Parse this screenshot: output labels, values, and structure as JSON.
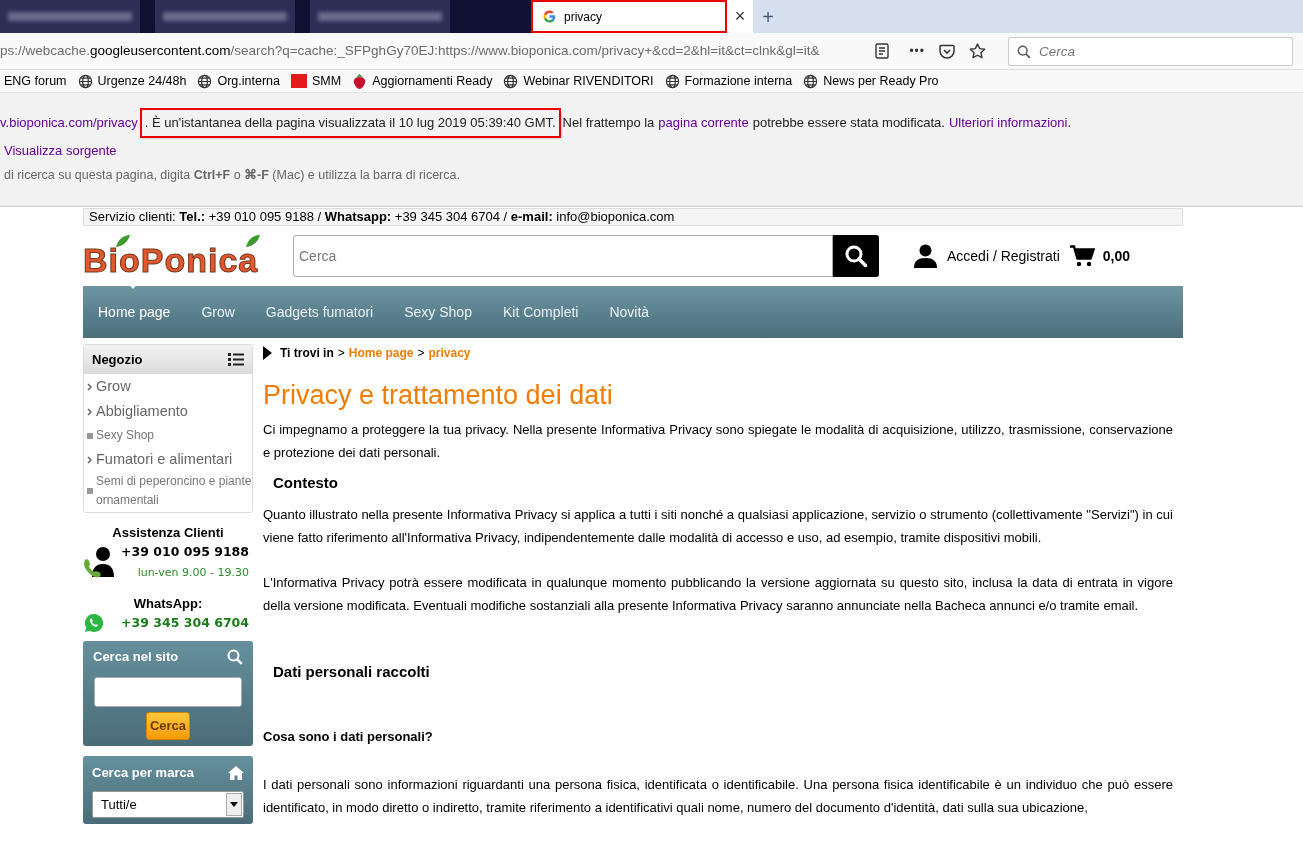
{
  "browser": {
    "tabs": [
      {
        "kind": "blurred",
        "selected": false,
        "highlighted": false
      },
      {
        "kind": "blurred",
        "selected": false,
        "highlighted": false
      },
      {
        "kind": "blurred",
        "selected": false,
        "highlighted": false
      },
      {
        "kind": "page",
        "title": "privacy",
        "selected": true,
        "highlighted": true
      }
    ],
    "close_tab": "×",
    "new_tab": "+",
    "url": {
      "prefix": "ps://webcache.",
      "domain": "googleusercontent.com",
      "rest": "/search?q=cache:_SFPghGy70EJ:https://www.bioponica.com/privacy+&cd=2&hl=it&ct=clnk&gl=it&"
    },
    "menu_dots": "•••",
    "search_placeholder": "Cerca",
    "bookmarks": [
      {
        "kind": "plain",
        "label": "ENG forum"
      },
      {
        "kind": "globe",
        "label": "Urgenze 24/48h"
      },
      {
        "kind": "globe",
        "label": "Org.interna"
      },
      {
        "kind": "badge",
        "label": "SMM"
      },
      {
        "kind": "strawberry",
        "label": "Aggiornamenti Ready"
      },
      {
        "kind": "globe",
        "label": "Webinar RIVENDITORI"
      },
      {
        "kind": "globe",
        "label": "Formazione interna"
      },
      {
        "kind": "globe",
        "label": "News per Ready Pro"
      }
    ]
  },
  "cache_banner": {
    "lines": [
      [
        {
          "kind": "link",
          "text": "v.bioponica.com/privacy",
          "highlighted": false
        },
        {
          "kind": "text",
          "text": ". È un'istantanea della pagina visualizzata il 10 lug 2019 05:39:40 GMT.",
          "highlighted": true
        },
        {
          "kind": "text",
          "text": "Nel frattempo la",
          "highlighted": false
        },
        {
          "kind": "link",
          "text": "pagina corrente",
          "highlighted": false
        },
        {
          "kind": "text",
          "text": "potrebbe essere stata modificata.",
          "highlighted": false
        },
        {
          "kind": "link",
          "text": "Ulteriori informazioni.",
          "highlighted": false
        }
      ],
      [
        {
          "kind": "link",
          "text": "Visualizza sorgente",
          "highlighted": false
        }
      ],
      [
        {
          "kind": "rich",
          "text": "di ricerca su questa pagina, digita **Ctrl+F** o **⌘-F** (Mac) e utilizza la barra di ricerca.",
          "highlighted": false
        }
      ]
    ]
  },
  "site": {
    "contact_bar": "Servizio clienti: **Tel.:** +39 010 095 9188 / **Whatsapp:** +39 345 304 6704 / **e-mail:** info@bioponica.com",
    "logo": "BioPonica",
    "search_placeholder": "Cerca",
    "account": "Accedi / Registrati",
    "cart_total": "0,00",
    "nav": [
      {
        "label": "Home page",
        "selected": true
      },
      {
        "label": "Grow",
        "selected": false
      },
      {
        "label": "Gadgets fumatori",
        "selected": false
      },
      {
        "label": "Sexy Shop",
        "selected": false
      },
      {
        "label": "Kit Completi",
        "selected": false
      },
      {
        "label": "Novità",
        "selected": false
      }
    ],
    "sidebar": {
      "shop_title": "Negozio",
      "categories": [
        {
          "kind": "arrow",
          "label": "Grow"
        },
        {
          "kind": "arrow",
          "label": "Abbigliamento"
        },
        {
          "kind": "square",
          "label": "Sexy Shop"
        },
        {
          "kind": "arrow",
          "label": "Fumatori e alimentari"
        },
        {
          "kind": "square",
          "label": "Semi di peperoncino e piante ornamentali"
        }
      ],
      "support_title": "Assistenza Clienti",
      "support_phone": "+39 010 095 9188",
      "support_hours": "lun-ven 9.00 - 19.30",
      "whatsapp_title": "WhatsApp:",
      "whatsapp_phone": "+39 345 304 6704",
      "site_search_title": "Cerca nel sito",
      "site_search_button": "Cerca",
      "brand_title": "Cerca per marca",
      "brand_value": "Tutti/e"
    },
    "breadcrumb": {
      "label": "Ti trovi in",
      "separator": ">",
      "items": [
        "Home page",
        "privacy"
      ]
    },
    "content": [
      {
        "kind": "title",
        "text": "Privacy e trattamento dei dati"
      },
      {
        "kind": "paragraph",
        "text": "Ci impegnamo a proteggere la tua privacy. Nella presente Informativa Privacy sono spiegate le modalità di acquisizione, utilizzo, trasmissione, conservazione e protezione dei dati personali."
      },
      {
        "kind": "heading",
        "text": "Contesto"
      },
      {
        "kind": "paragraph",
        "text": "Quanto illustrato nella presente Informativa Privacy si applica a tutti i siti nonché a qualsiasi applicazione, servizio o strumento (collettivamente \"Servizi\") in cui viene fatto riferimento all'Informativa Privacy, indipendentemente dalle modalità di accesso e uso, ad esempio, tramite dispositivi mobili."
      },
      {
        "kind": "paragraph",
        "text": "L'Informativa Privacy potrà essere modificata in qualunque momento pubblicando la versione aggiornata su questo sito, inclusa la data di entrata in vigore della versione modificata. Eventuali modifiche sostanziali alla presente Informativa Privacy saranno annunciate nella Bacheca annunci e/o tramite email."
      },
      {
        "kind": "heading",
        "text": "Dati personali raccolti"
      },
      {
        "kind": "subheading",
        "text": "Cosa sono i dati personali?"
      },
      {
        "kind": "paragraph",
        "text": "I dati personali sono informazioni riguardanti una persona fisica, identificata o identificabile. Una persona fisica identificabile è un individuo che può essere identificato, in modo diretto o indiretto, tramite riferimento a identificativi quali nome, numero del documento d'identità, dati sulla sua ubicazione,"
      }
    ]
  }
}
